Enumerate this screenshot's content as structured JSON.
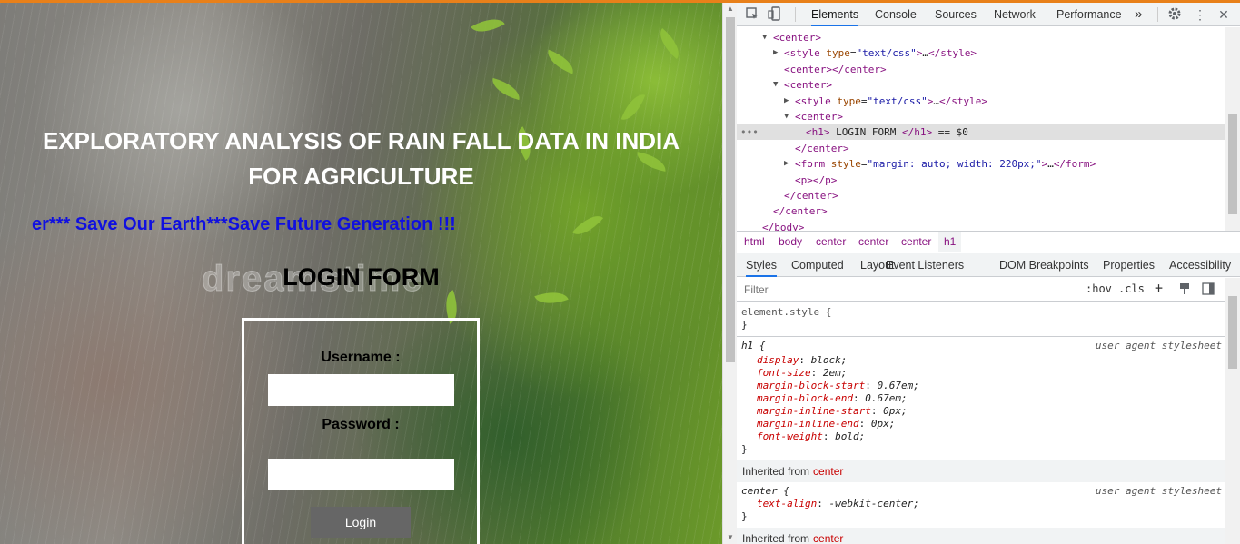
{
  "page": {
    "title_line1": "EXPLORATORY ANALYSIS OF RAIN FALL DATA IN INDIA",
    "title_line2": "FOR AGRICULTURE",
    "marquee": "er*** Save Our Earth***Save Future Generation !!!",
    "watermark": "dreamstime",
    "login_heading": "LOGIN FORM",
    "username_label": "Username :",
    "password_label": "Password :",
    "login_button": "Login"
  },
  "devtools": {
    "tabs": [
      "Elements",
      "Console",
      "Sources",
      "Network",
      "Performance"
    ],
    "active_tab": "Elements",
    "more_tabs": "»",
    "dom_lines": [
      {
        "indent": 0,
        "tri": "▼",
        "html": "<center>"
      },
      {
        "indent": 1,
        "tri": "▶",
        "html": "<style type=\"text/css\">…</style>"
      },
      {
        "indent": 1,
        "tri": "",
        "html": "<center></center>"
      },
      {
        "indent": 1,
        "tri": "▼",
        "html": "<center>"
      },
      {
        "indent": 2,
        "tri": "▶",
        "html": "<style type=\"text/css\">…</style>"
      },
      {
        "indent": 2,
        "tri": "▼",
        "html": "<center>"
      },
      {
        "indent": 3,
        "tri": "",
        "html": "<h1> LOGIN FORM </h1> == $0",
        "selected": true
      },
      {
        "indent": 2,
        "tri": "",
        "html": "</center>"
      },
      {
        "indent": 2,
        "tri": "▶",
        "html": "<form style=\"margin: auto; width: 220px;\">…</form>"
      },
      {
        "indent": 2,
        "tri": "",
        "html": "<p></p>"
      },
      {
        "indent": 1,
        "tri": "",
        "html": "</center>"
      },
      {
        "indent": 0,
        "tri": "",
        "html": "</center>"
      },
      {
        "indent": -1,
        "tri": "",
        "html": "</body>"
      }
    ],
    "breadcrumbs": [
      "html",
      "body",
      "center",
      "center",
      "center",
      "h1"
    ],
    "sub_tabs": [
      "Styles",
      "Computed",
      "Layout",
      "Event Listeners",
      "DOM Breakpoints",
      "Properties",
      "Accessibility"
    ],
    "active_sub_tab": "Styles",
    "filter_placeholder": "Filter",
    "hov": ":hov",
    "cls": ".cls",
    "element_style": "element.style {",
    "close_brace": "}",
    "h1_rule": {
      "selector": "h1 {",
      "origin": "user agent stylesheet",
      "props": [
        {
          "name": "display",
          "value": "block;"
        },
        {
          "name": "font-size",
          "value": "2em;"
        },
        {
          "name": "margin-block-start",
          "value": "0.67em;"
        },
        {
          "name": "margin-block-end",
          "value": "0.67em;"
        },
        {
          "name": "margin-inline-start",
          "value": "0px;"
        },
        {
          "name": "margin-inline-end",
          "value": "0px;"
        },
        {
          "name": "font-weight",
          "value": "bold;"
        }
      ]
    },
    "inherited_label": "Inherited from",
    "inherited_tag": "center",
    "center_rule": {
      "selector": "center {",
      "origin": "user agent stylesheet",
      "props": [
        {
          "name": "text-align",
          "value": "-webkit-center;"
        }
      ]
    }
  }
}
